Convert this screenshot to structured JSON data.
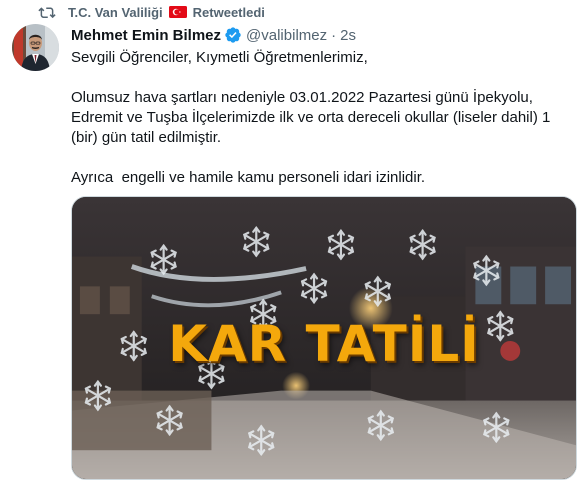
{
  "retweet": {
    "icon": "retweet-icon",
    "by": "T.C. Van Valiliği",
    "flag_icon": "turkey-flag-icon",
    "label": "Retweetledi"
  },
  "tweet": {
    "author": {
      "display_name": "Mehmet Emin Bilmez",
      "verified_icon": "verified-badge-icon",
      "handle": "@valibilmez",
      "time": "2s"
    },
    "text": {
      "p1": "Sevgili Öğrenciler, Kıymetli Öğretmenlerimiz,",
      "p2": "Olumsuz hava şartları nedeniyle 03.01.2022 Pazartesi günü İpekyolu, Edremit ve Tuşba İlçelerimizde ilk ve orta dereceli okullar (liseler dahil) 1 (bir) gün tatil edilmiştir.",
      "p3": "Ayrıca  engelli ve hamile kamu personeli idari izinlidir."
    },
    "media": {
      "overlay_text": "KAR TATİLİ",
      "overlay_color": "#f4a80c"
    }
  },
  "colors": {
    "text": "#0f1419",
    "secondary": "#536471",
    "verified": "#1d9bf0",
    "flag": "#e30a17"
  }
}
